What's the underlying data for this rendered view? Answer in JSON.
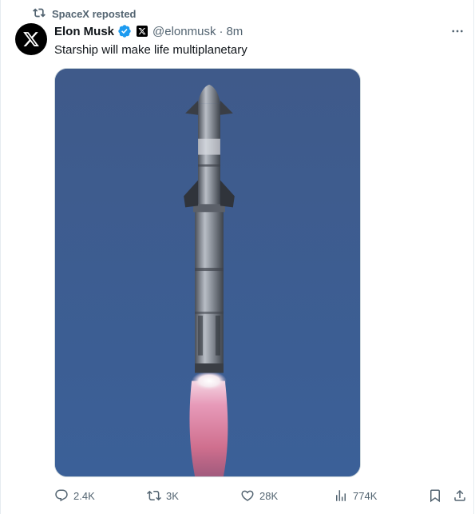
{
  "repost": {
    "label": "SpaceX reposted",
    "icon": "repost-icon"
  },
  "author": {
    "avatar_icon": "x-logo-icon",
    "name": "Elon Musk",
    "verified_icon": "verified-badge-icon",
    "affiliation_icon": "x-affiliate-badge-icon",
    "handle": "@elonmusk",
    "separator": "·",
    "time": "8m"
  },
  "more_icon": "more-icon",
  "post": {
    "text": "Starship will make life multiplanetary",
    "media": {
      "description_icon": "starship-launch-image"
    }
  },
  "actions": {
    "replies": "2.4K",
    "reposts": "3K",
    "likes": "28K",
    "views": "774K"
  },
  "colors": {
    "text": "#0f1419",
    "secondary": "#536471",
    "verified": "#1d9bf0",
    "sky": "#3d5d93"
  }
}
